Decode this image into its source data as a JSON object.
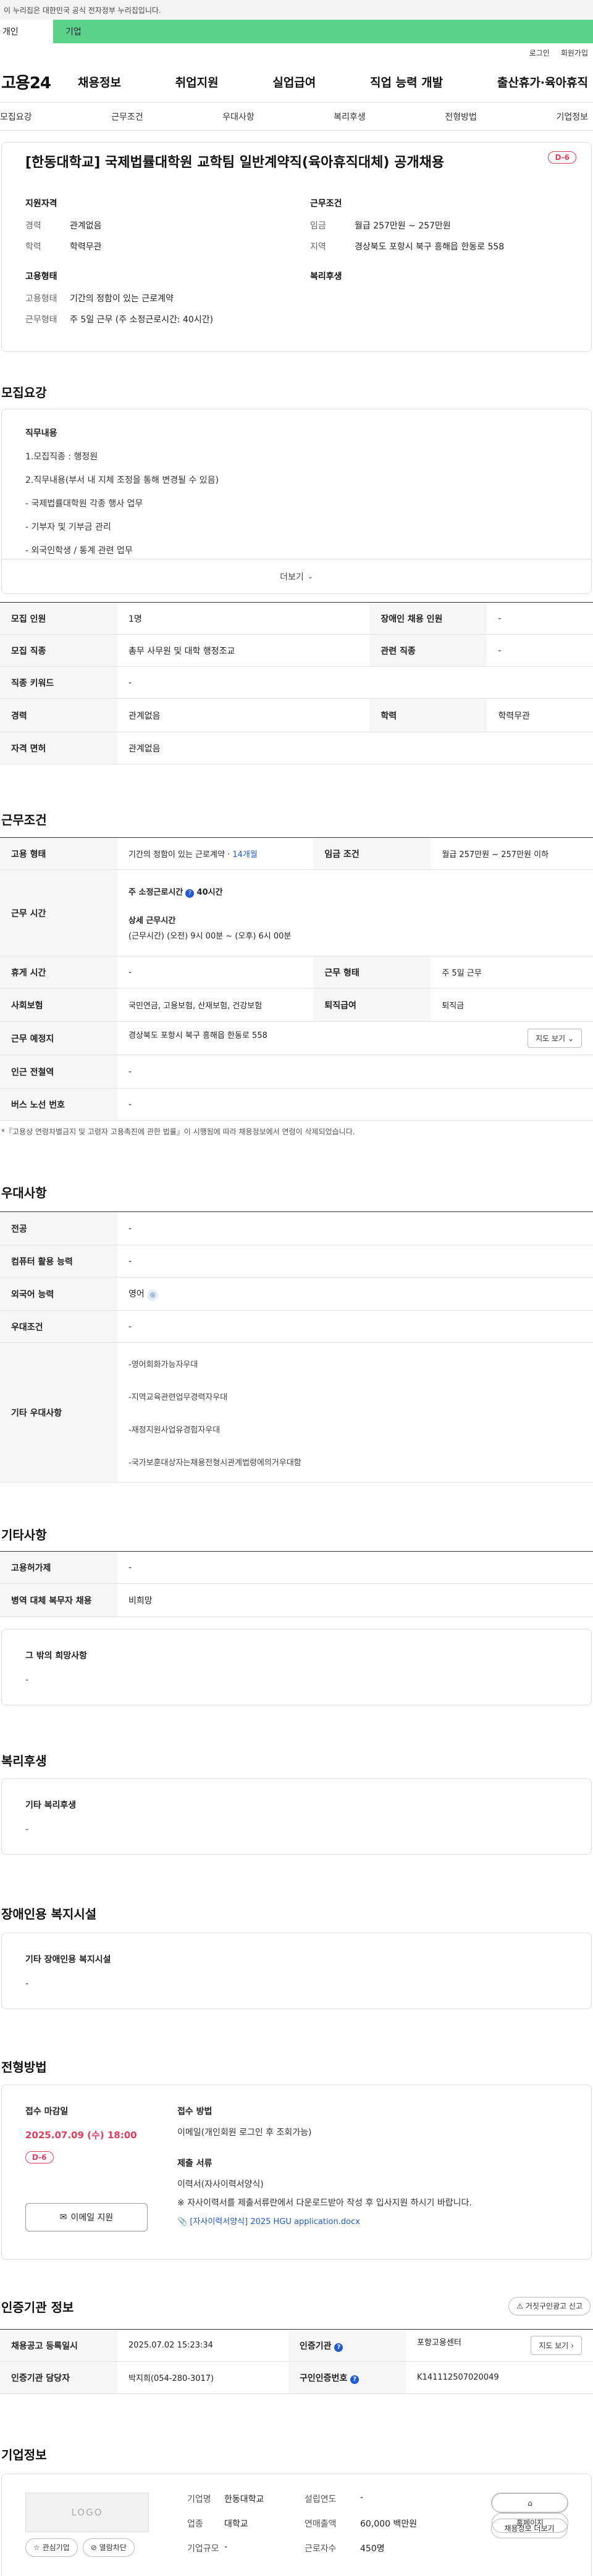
{
  "gov_bar": {
    "text": "이 누리집은 대한민국 공식 전자정부 누리집입니다."
  },
  "site_tabs": {
    "personal": "개인",
    "company": "기업"
  },
  "util": {
    "login": "로그인",
    "signup": "회원가입"
  },
  "header": {
    "logo": "고용24",
    "menu": [
      "채용정보",
      "취업지원",
      "실업급여",
      "직업 능력 개발",
      "출산휴가·육아휴직"
    ]
  },
  "anchor_tabs": [
    "모집요강",
    "근무조건",
    "우대사항",
    "복리후생",
    "전형방법",
    "기업정보"
  ],
  "summary": {
    "title": "[한동대학교] 국제법률대학원 교학팀 일반계약직(육아휴직대체) 공개채용",
    "dday": "D-6",
    "qualification": {
      "heading": "지원자격",
      "rows": [
        [
          "경력",
          "관계없음"
        ],
        [
          "학력",
          "학력무관"
        ]
      ]
    },
    "conditions": {
      "heading": "근무조건",
      "rows": [
        [
          "임금",
          "월급 257만원 ~ 257만원"
        ],
        [
          "지역",
          "경상북도 포항시 북구 흥해읍 한동로 558"
        ]
      ]
    },
    "employment": {
      "heading": "고용형태",
      "rows": [
        [
          "고용형태",
          "기간의 정함이 있는 근로계약"
        ],
        [
          "근무형태",
          "주 5일 근무 (주 소정근로시간: 40시간)"
        ]
      ]
    },
    "welfare": {
      "heading": "복리후생"
    }
  },
  "recruit": {
    "section_title": "모집요강",
    "detail_heading": "직무내용",
    "detail_lines": [
      "1.모집직종 : 행정원",
      "2.직무내용(부서 내 지체 조정을 통해 변경될 수 있음)",
      "- 국제법률대학원 각종 행사 업무",
      "- 기부자 및 기부금 관리",
      "- 외국인학생 / 통계 관련 업무"
    ],
    "more": "더보기",
    "table": {
      "headcount_k": "모집 인원",
      "headcount_v": "1명",
      "disabled_k": "장애인 채용 인원",
      "disabled_v": "-",
      "job_k": "모집 직종",
      "job_v": "총무 사무원 및 대학 행정조교",
      "related_k": "관련 직종",
      "related_v": "-",
      "keyword_k": "직종 키워드",
      "keyword_v": "-",
      "career_k": "경력",
      "career_v": "관계없음",
      "edu_k": "학력",
      "edu_v": "학력무관",
      "license_k": "자격 면허",
      "license_v": "관계없음"
    }
  },
  "conditions": {
    "section_title": "근무조건",
    "type_k": "고용 형태",
    "type_v": "기간의 정함이 있는 근로계약 · ",
    "type_months": "14개월",
    "wage_k": "임금 조건",
    "wage_v": "월급 257만원 ~ 257만원 이하",
    "hours_k": "근무 시간",
    "hours_weekly_label": "주 소정근로시간",
    "hours_weekly_value": "40시간",
    "hours_detail_h": "상세 근무시간",
    "hours_detail_v": "(근무시간) (오전) 9시 00분 ~ (오후) 6시 00분",
    "rest_k": "휴게 시간",
    "rest_v": "-",
    "shift_k": "근무 형태",
    "shift_v": "주 5일 근무",
    "insurance_k": "사회보험",
    "insurance_v": "국민연금, 고용보험, 산재보험, 건강보험",
    "retire_k": "퇴직급여",
    "retire_v": "퇴직금",
    "place_k": "근무 예정지",
    "place_v": "경상북도 포항시 북구 흥해읍 한동로 558",
    "map_btn": "지도 보기",
    "subway_k": "인근 전철역",
    "subway_v": "-",
    "bus_k": "버스 노선 번호",
    "bus_v": "-",
    "note": "*『고용상 연령차별금지 및 고령자 고용촉진에 관한 법률』이 시행됨에 따라 채용정보에서 연령이 삭제되었습니다."
  },
  "preference": {
    "section_title": "우대사항",
    "major_k": "전공",
    "major_v": "-",
    "computer_k": "컴퓨터 활용 능력",
    "computer_v": "-",
    "lang_k": "외국어 능력",
    "lang_v": "영어",
    "cond_k": "우대조건",
    "cond_v": "-",
    "etc_k": "기타 우대사항",
    "etc_items": [
      "-영어회화가능자우대",
      "-지역교육관련업무경력자우대",
      "-재정지원사업유경험자우대",
      "-국가보훈대상자는채용전형시관계법령에의거우대함"
    ]
  },
  "other": {
    "section_title": "기타사항",
    "insurance_k": "고용허가제",
    "insurance_v": "-",
    "military_k": "병역 대체 복무자 채용",
    "military_v": "비희망",
    "extra_h": "그 밖의 희망사항",
    "extra_v": "-"
  },
  "welfare": {
    "section_title": "복리후생",
    "h": "기타 복리후생",
    "v": "-"
  },
  "disabled": {
    "section_title": "장애인용 복지시설",
    "h": "기타 장애인용 복지시설",
    "v": "-"
  },
  "selection": {
    "section_title": "전형방법",
    "deadline_h": "접수 마감일",
    "deadline_v": "2025.07.09 (수) 18:00",
    "dday": "D-6",
    "email_btn": "이메일 지원",
    "method_h": "접수 방법",
    "method_v": "이메일(개인회원 로그인 후 조회가능)",
    "docs_h": "제출 서류",
    "docs_l1": "이력서(자사이력서양식)",
    "docs_l2": "※ 자사이력서를 제출서류란에서 다운로드받아 작성 후 입사지원 하시기 바랍니다.",
    "docs_file": "[자사이력서양식] 2025 HGU application.docx"
  },
  "agency": {
    "section_title": "인증기관 정보",
    "report_btn": "거짓구인광고 신고",
    "reg_k": "채용공고 등록일시",
    "reg_v": "2025.07.02 15:23:34",
    "org_k": "인증기관",
    "org_v": "포항고용센터",
    "map_btn": "지도 보기",
    "manager_k": "인증기관 담당자",
    "manager_v": "박지희(054-280-3017)",
    "num_k": "구인인증번호",
    "num_v": "K141112507020049"
  },
  "company": {
    "section_title": "기업정보",
    "logo": "LOGO",
    "name_k": "기업명",
    "name_v": "한동대학교",
    "founded_k": "설립연도",
    "founded_v": "-",
    "biz_k": "업종",
    "biz_v": "대학교",
    "sales_k": "연매출액",
    "sales_v": "60,000 백만원",
    "size_k": "기업규모",
    "size_v": "-",
    "emp_k": "근로자수",
    "emp_v": "450명",
    "btn_home": "홈페이지",
    "btn_more": "채용정보 더보기",
    "btn_interest": "관심기업",
    "btn_block": "열람차단"
  }
}
